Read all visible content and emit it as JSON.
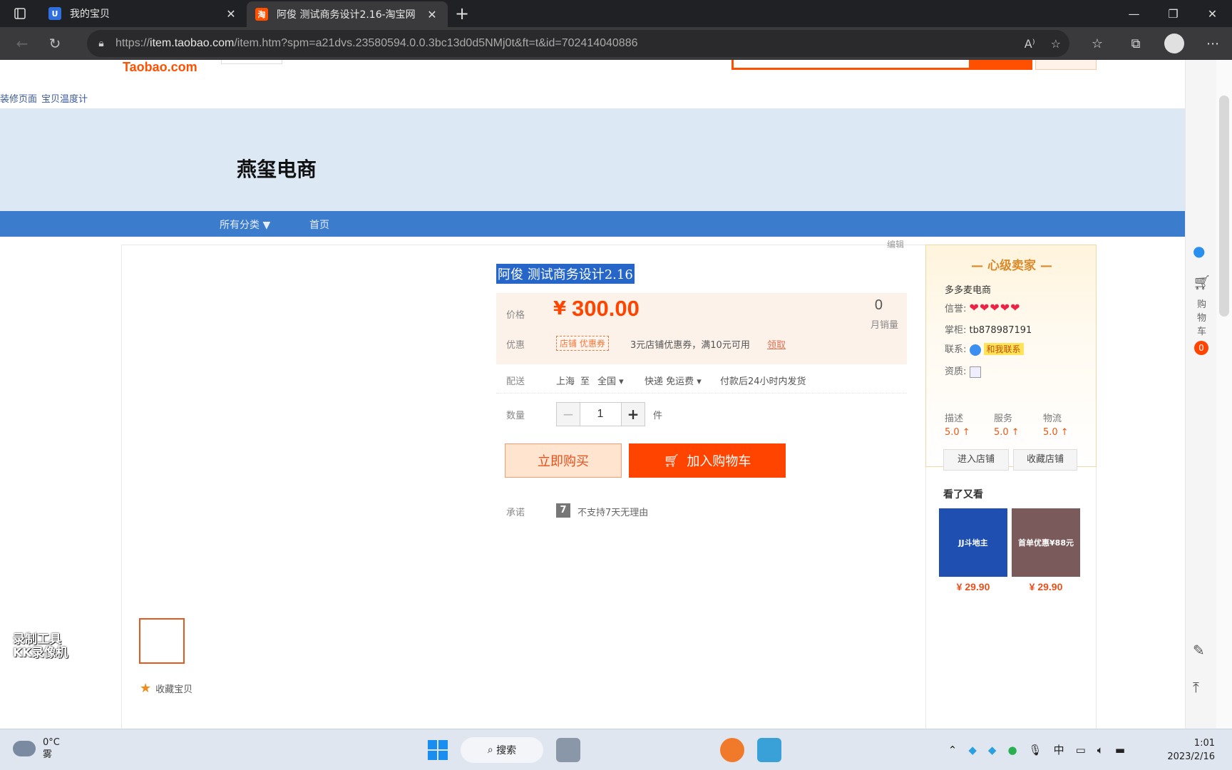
{
  "browser": {
    "tabs": [
      {
        "title": "我的宝贝",
        "icon": "taobao-sign-icon",
        "active": false
      },
      {
        "title": "阿俊 测试商务设计2.16-淘宝网",
        "icon": "taobao-icon",
        "active": true
      }
    ],
    "url_prefix": "https://",
    "url_host": "item.taobao.com",
    "url_path": "/item.htm?spm=a21dvs.23580594.0.0.3bc13d0d5NMj0t&ft=t&id=702414040886"
  },
  "site": {
    "logo": "Taobao.com",
    "decor_links": [
      "装修页面",
      "宝贝温度计"
    ]
  },
  "shop": {
    "name": "燕玺电商",
    "nav": [
      "所有分类 ▼",
      "首页"
    ],
    "edit_label": "编辑"
  },
  "product": {
    "title": "阿俊 测试商务设计2.16",
    "price_label": "价格",
    "currency": "¥",
    "price": "300.00",
    "monthly_sales": "0",
    "monthly_sales_label": "月销量",
    "promo_label": "优惠",
    "coupon_tag": "店铺 优惠券",
    "coupon_text": "3元店铺优惠券，满10元可用",
    "coupon_link": "领取",
    "shipping_label": "配送",
    "ship_from": "上海",
    "ship_to_word": "至",
    "ship_to": "全国 ▾",
    "ship_method": "快递 免运费 ▾",
    "ship_time": "付款后24小时内发货",
    "qty_label": "数量",
    "qty_minus": "−",
    "qty": "1",
    "qty_plus": "+",
    "qty_unit": "件",
    "buy_now": "立即购买",
    "add_cart": "加入购物车",
    "promise_label": "承诺",
    "promise_icon": "7",
    "promise_text": "不支持7天无理由",
    "favorite": "收藏宝贝"
  },
  "seller": {
    "level": "— 心级卖家 —",
    "name": "多多麦电商",
    "credit_label": "信誉:",
    "credit_hearts": "❤❤❤❤❤",
    "keeper_label": "掌柜:",
    "keeper": "tb878987191",
    "contact_label": "联系:",
    "contact_btn": "和我联系",
    "cert_label": "资质:",
    "scores": [
      {
        "label": "描述",
        "value": "5.0 ↑"
      },
      {
        "label": "服务",
        "value": "5.0 ↑"
      },
      {
        "label": "物流",
        "value": "5.0 ↑"
      }
    ],
    "enter_shop": "进入店铺",
    "fav_shop": "收藏店铺"
  },
  "also_viewed": {
    "title": "看了又看",
    "items": [
      {
        "img_text": "JJ斗地主",
        "price": "¥ 29.90",
        "color": "#1f4fb0"
      },
      {
        "img_text": "首单优惠¥88元",
        "price": "¥ 29.90",
        "color": "#7a5a5a"
      }
    ]
  },
  "rail": {
    "cart_label": "购物车",
    "cart_count": "0"
  },
  "watermark": [
    "录制工具",
    "KK录像机"
  ],
  "taskbar": {
    "temp": "0°C",
    "weather": "雾",
    "search": "搜索",
    "ime": "中",
    "time": "1:01",
    "date": "2023/2/16"
  }
}
